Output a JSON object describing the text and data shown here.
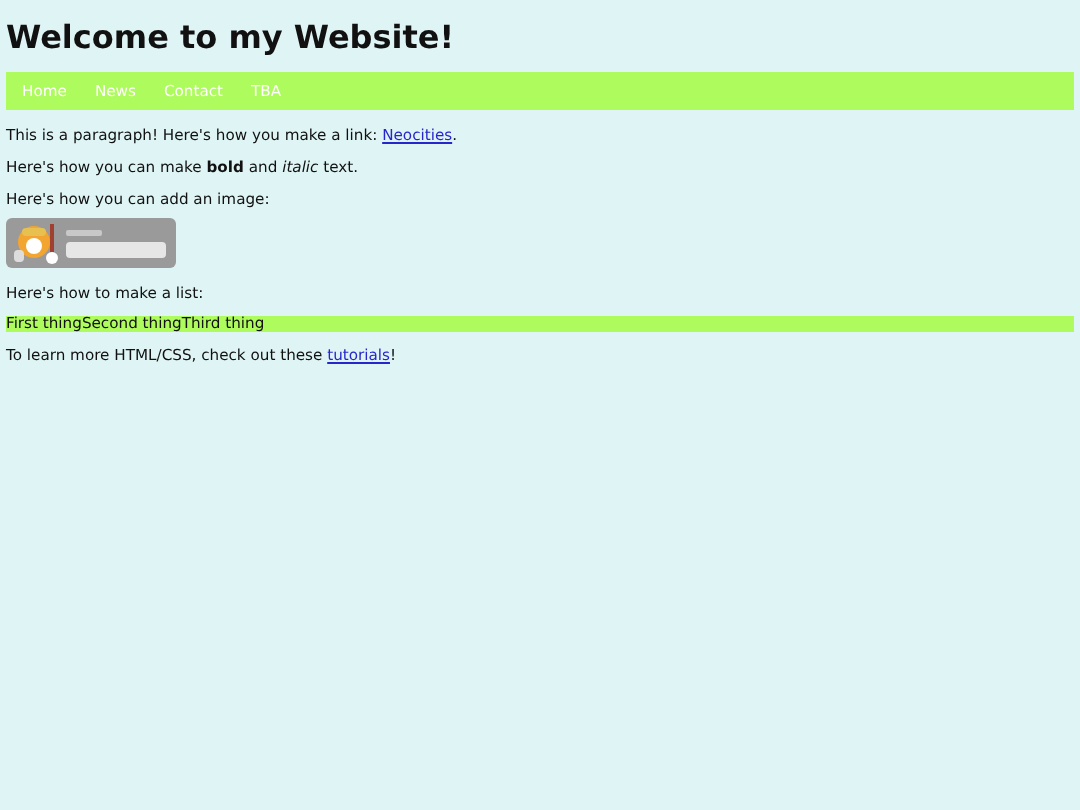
{
  "title": "Welcome to my Website!",
  "nav": [
    {
      "label": "Home"
    },
    {
      "label": "News"
    },
    {
      "label": "Contact"
    },
    {
      "label": "TBA"
    }
  ],
  "intro": {
    "before": "This is a paragraph! Here's how you make a link: ",
    "link": "Neocities",
    "after": "."
  },
  "styled": "Here's how you can make **bold** and *italic* text.",
  "image_caption": "Here's how you can add an image:",
  "image": {
    "kind": "picture"
  },
  "list_caption": "Here's how to make a list:",
  "list": [
    "First thing",
    "Second thing",
    "Third thing"
  ],
  "outro": {
    "before": "To learn more HTML/CSS, check out these ",
    "link": "tutorials",
    "after": "!"
  }
}
